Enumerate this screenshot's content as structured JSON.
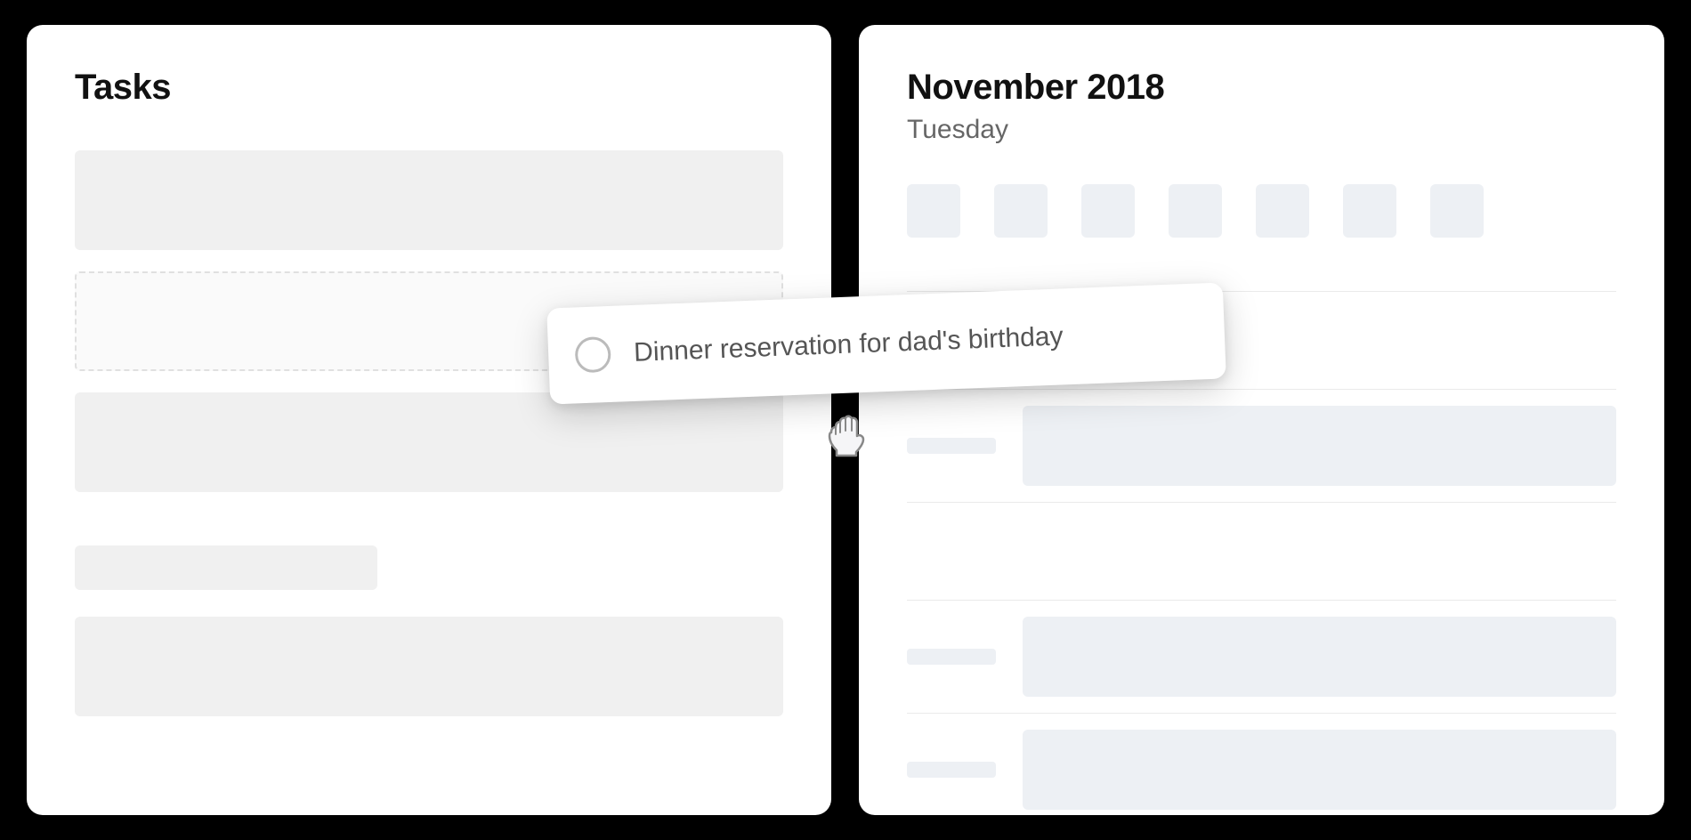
{
  "tasks": {
    "title": "Tasks"
  },
  "calendar": {
    "title": "November 2018",
    "subtitle": "Tuesday"
  },
  "dragged_task": {
    "text": "Dinner reservation for dad's birthday"
  }
}
